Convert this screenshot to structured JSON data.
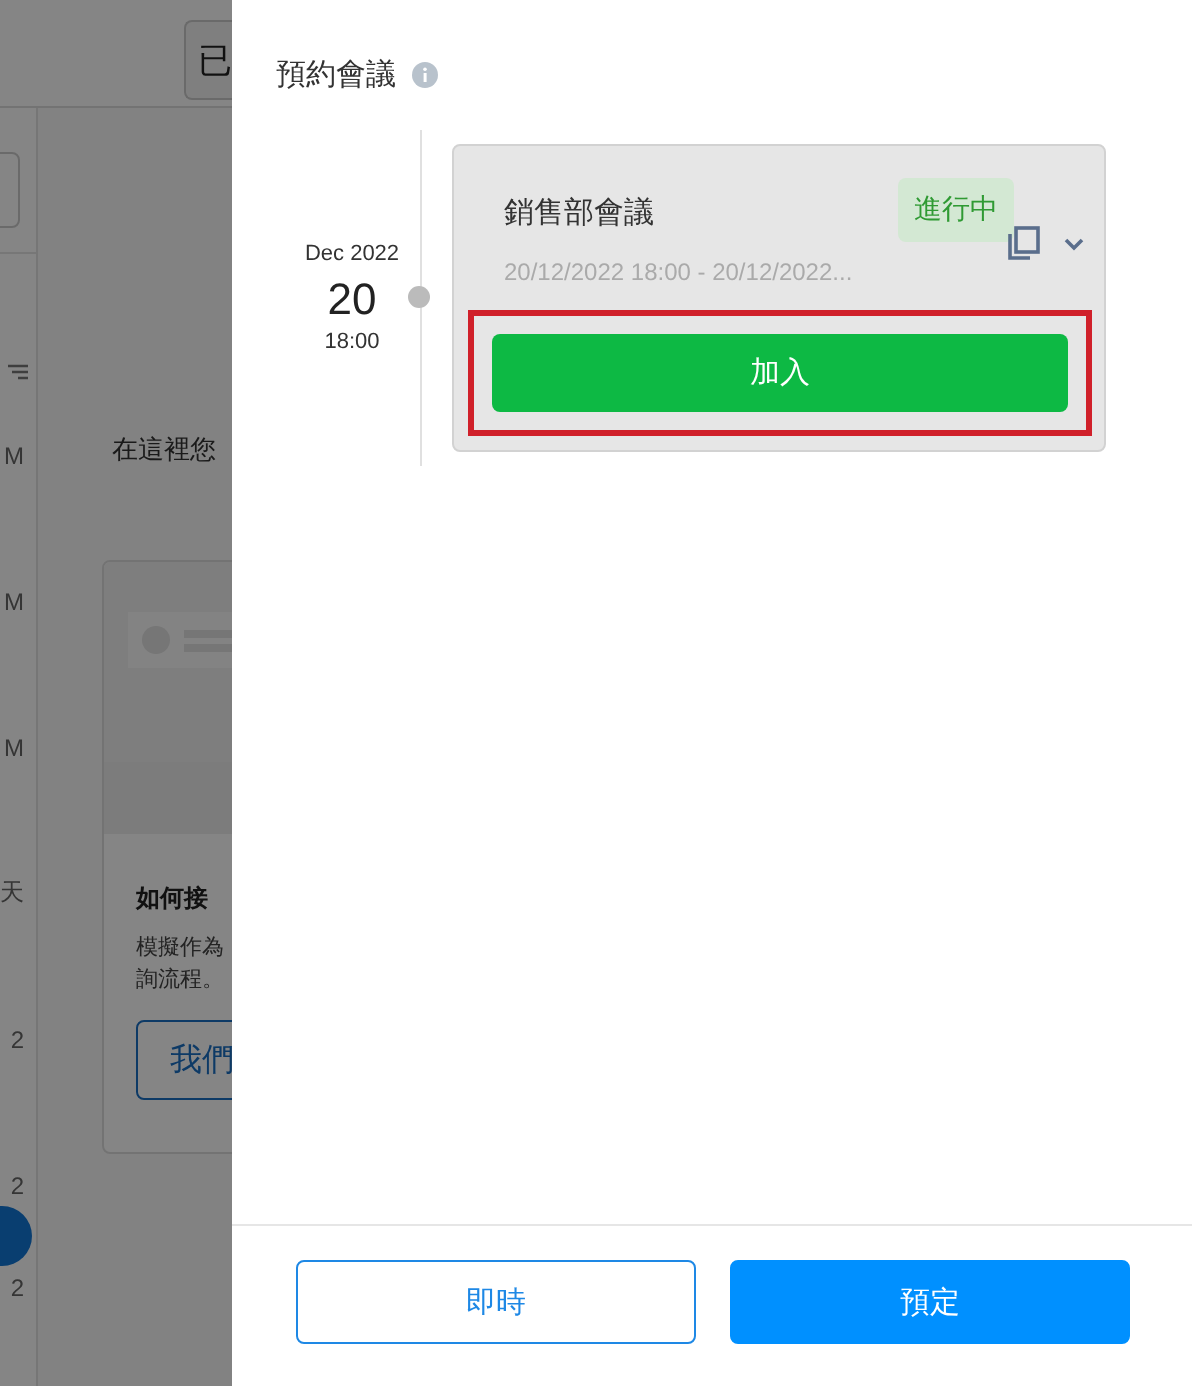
{
  "background_page": {
    "top_button": "已",
    "sidebar_times": [
      "M",
      "M",
      "M",
      "天",
      "2",
      "2",
      "2"
    ],
    "intro_text": "在這裡您",
    "card": {
      "title": "如何接",
      "body_lines": [
        "模擬作為",
        "詢流程。"
      ],
      "button": "我們"
    }
  },
  "drawer": {
    "title": "預約會議",
    "meetings": [
      {
        "month": "Dec 2022",
        "day": "20",
        "time": "18:00",
        "title": "銷售部會議",
        "status": "進行中",
        "range": "20/12/2022 18:00 - 20/12/2022...",
        "expanded": false,
        "join": {
          "label": "加入",
          "highlighted": true
        }
      }
    ],
    "buttons": [
      {
        "label": "即時",
        "kind": "secondary"
      },
      {
        "label": "預定",
        "kind": "primary"
      }
    ]
  }
}
